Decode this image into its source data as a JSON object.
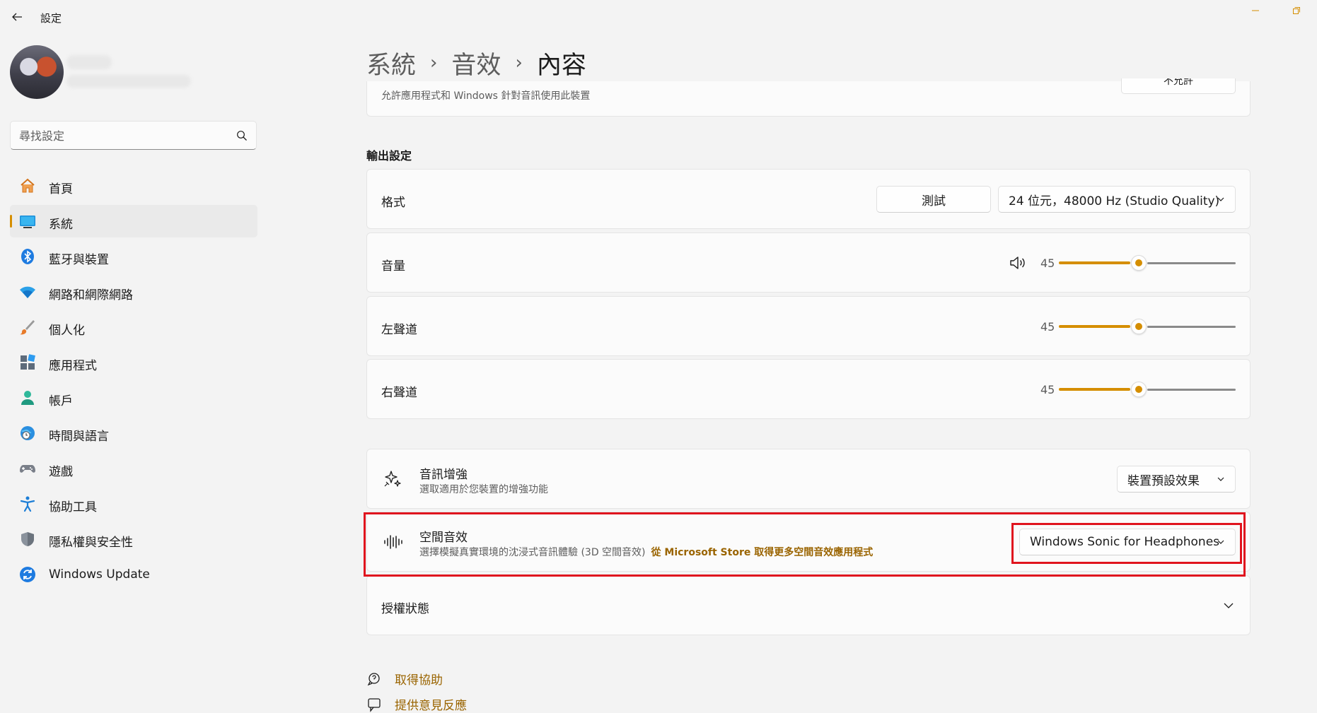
{
  "app": {
    "title": "設定"
  },
  "search": {
    "placeholder": "尋找設定"
  },
  "sidebar": {
    "items": [
      {
        "label": "首頁",
        "icon": "home-icon",
        "active": false
      },
      {
        "label": "系統",
        "icon": "system-icon",
        "active": true
      },
      {
        "label": "藍牙與裝置",
        "icon": "bluetooth-icon",
        "active": false
      },
      {
        "label": "網路和網際網路",
        "icon": "wifi-icon",
        "active": false
      },
      {
        "label": "個人化",
        "icon": "brush-icon",
        "active": false
      },
      {
        "label": "應用程式",
        "icon": "apps-icon",
        "active": false
      },
      {
        "label": "帳戶",
        "icon": "account-icon",
        "active": false
      },
      {
        "label": "時間與語言",
        "icon": "globe-clock-icon",
        "active": false
      },
      {
        "label": "遊戲",
        "icon": "gamepad-icon",
        "active": false
      },
      {
        "label": "協助工具",
        "icon": "accessibility-icon",
        "active": false
      },
      {
        "label": "隱私權與安全性",
        "icon": "shield-icon",
        "active": false
      },
      {
        "label": "Windows Update",
        "icon": "update-icon",
        "active": false
      }
    ]
  },
  "breadcrumb": {
    "level1": "系統",
    "level2": "音效",
    "current": "內容"
  },
  "partial_card": {
    "desc": "允許應用程式和 Windows 針對音訊使用此裝置",
    "button_label": "不允許"
  },
  "output": {
    "section_title": "輸出設定",
    "format": {
      "label": "格式",
      "test_button": "測試",
      "selected": "24 位元，48000 Hz (Studio Quality)"
    },
    "volume": {
      "label": "音量",
      "value": "45"
    },
    "left_channel": {
      "label": "左聲道",
      "value": "45"
    },
    "right_channel": {
      "label": "右聲道",
      "value": "45"
    }
  },
  "enhancement": {
    "title": "音訊增強",
    "desc": "選取適用於您裝置的增強功能",
    "selected": "裝置預設效果"
  },
  "spatial": {
    "title": "空間音效",
    "desc": "選擇模擬真實環境的沈浸式音訊體驗 (3D 空間音效)",
    "store_link": "從 Microsoft Store 取得更多空間音效應用程式",
    "selected": "Windows Sonic for Headphones"
  },
  "license": {
    "label": "授權狀態"
  },
  "footer": {
    "help": "取得協助",
    "feedback": "提供意見反應"
  },
  "colors": {
    "accent": "#d58e00",
    "highlight": "#e0141e",
    "link": "#9a6400"
  }
}
